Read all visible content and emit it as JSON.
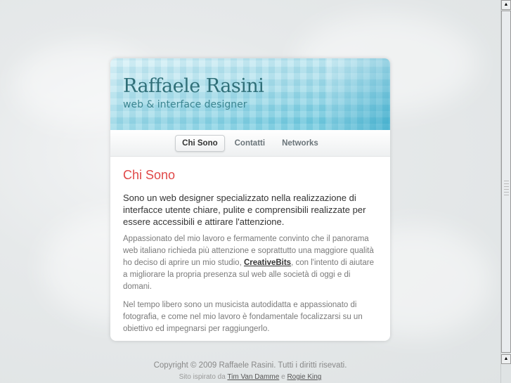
{
  "header": {
    "title": "Raffaele Rasini",
    "subtitle": "web & interface designer"
  },
  "nav": [
    {
      "label": "Chi Sono",
      "active": true
    },
    {
      "label": "Contatti"
    },
    {
      "label": "Networks"
    }
  ],
  "content": {
    "heading": "Chi Sono",
    "lead": "Sono un web designer specializzato nella realizzazione di interfacce utente chiare, pulite e comprensibili realizzate per essere accessibili e attirare l'attenzione.",
    "p1_before": "Appassionato del mio lavoro e fermamente convinto che il panorama web italiano richieda più attenzione e soprattutto una maggiore qualità ho deciso di aprire un mio studio, ",
    "p1_link": "CreativeBits",
    "p1_after": ", con l'intento di aiutare a migliorare la propria presenza sul web alle società di oggi e di domani.",
    "p2": "Nel tempo libero sono un musicista autodidatta e appassionato di fotografia, e come nel mio lavoro è fondamentale focalizzarsi su un obiettivo ed impegnarsi per raggiungerlo."
  },
  "footer": {
    "copyright": "Copyright © 2009 Raffaele Rasini. Tutti i diritti risevati.",
    "inspired": "Sito ispirato da",
    "link1": "Tim Van Damme",
    "and": "e",
    "link2": "Rogie King"
  }
}
